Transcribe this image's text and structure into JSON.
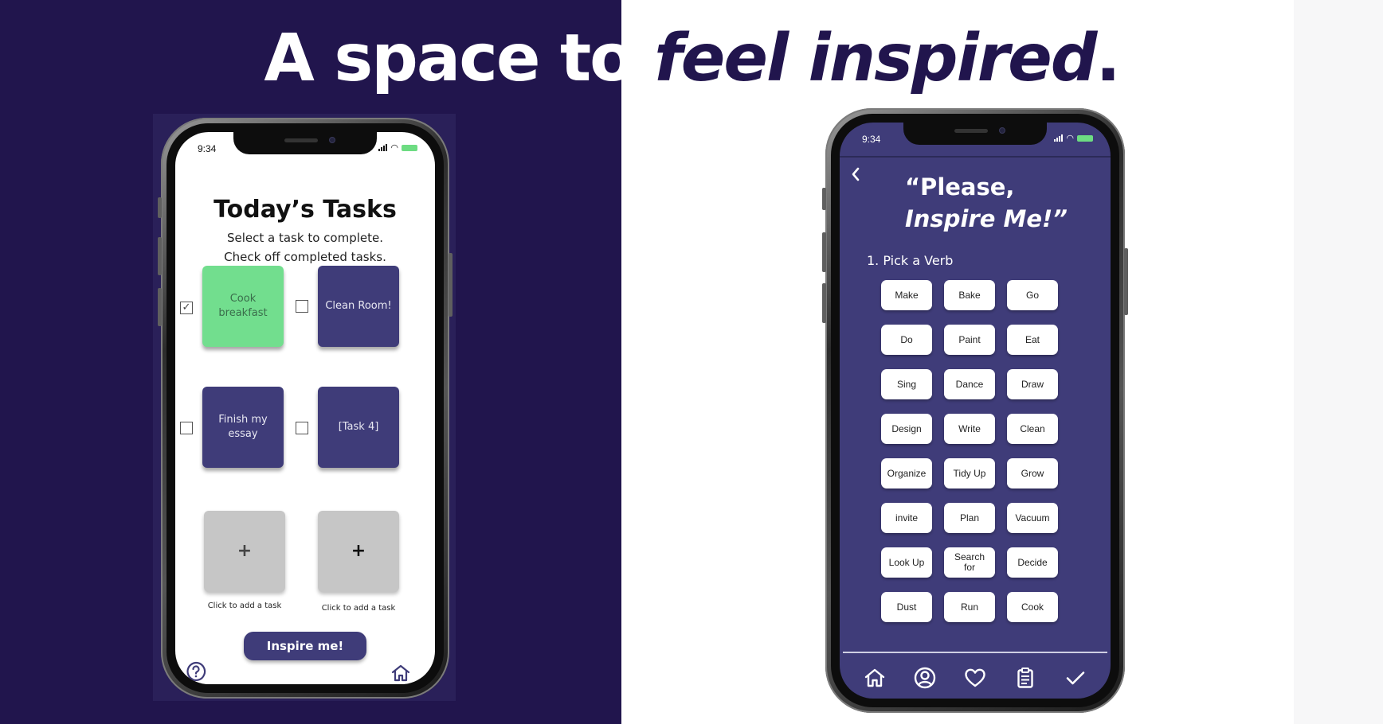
{
  "headline": {
    "part1": "A space to ",
    "part2": "feel inspired",
    "part3": "."
  },
  "colors": {
    "navy": "#21154d",
    "task_purple": "#3f3c79",
    "task_done_green": "#72de8e",
    "add_gray": "#c6c6c6",
    "battery_green": "#6ddc82"
  },
  "phone_left": {
    "status_time": "9:34",
    "title": "Today’s Tasks",
    "subtitle_line1": "Select a task to complete.",
    "subtitle_line2": "Check off completed tasks.",
    "tasks": [
      {
        "label": "Cook breakfast",
        "checked": true,
        "checkbox_text": "✓"
      },
      {
        "label": "Clean Room!",
        "checked": false,
        "checkbox_text": ""
      },
      {
        "label": "Finish my essay",
        "checked": false,
        "checkbox_text": ""
      },
      {
        "label": "[Task 4]",
        "checked": false,
        "checkbox_text": ""
      }
    ],
    "add_slots": [
      {
        "symbol": "+",
        "caption": "Click to add a task"
      },
      {
        "symbol": "+",
        "caption": "Click to add a task"
      }
    ],
    "inspire_button": "Inspire me!",
    "icons": [
      "help-icon",
      "home-icon"
    ]
  },
  "phone_right": {
    "status_time": "9:34",
    "quote_line1": "“Please,",
    "quote_line2": "Inspire Me!”",
    "step_label": "1. Pick a Verb",
    "verbs": [
      "Make",
      "Bake",
      "Go",
      "Do",
      "Paint",
      "Eat",
      "Sing",
      "Dance",
      "Draw",
      "Design",
      "Write",
      "Clean",
      "Organize",
      "Tidy Up",
      "Grow",
      "invite",
      "Plan",
      "Vacuum",
      "Look Up",
      "Search for",
      "Decide",
      "Dust",
      "Run",
      "Cook"
    ],
    "nav_icons": [
      "home-icon",
      "profile-icon",
      "heart-icon",
      "clipboard-icon",
      "check-icon"
    ]
  }
}
